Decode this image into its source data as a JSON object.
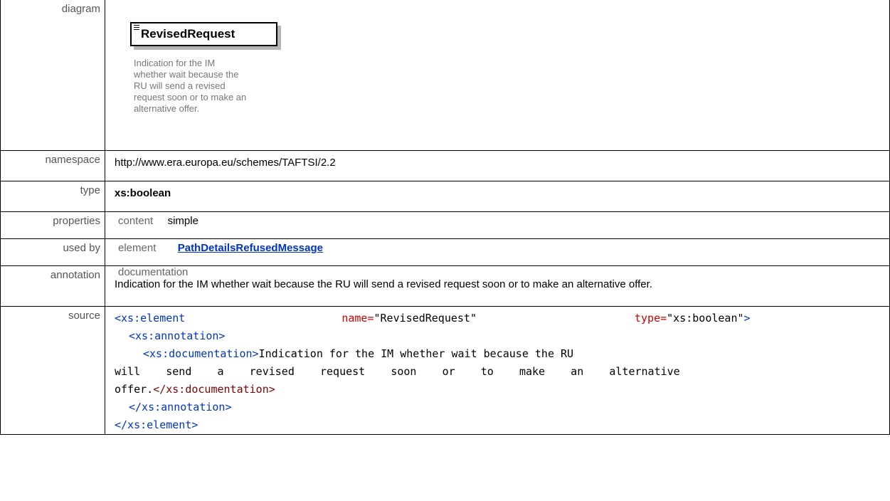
{
  "labels": {
    "diagram": "diagram",
    "namespace": "namespace",
    "type": "type",
    "properties": "properties",
    "used_by": "used by",
    "annotation": "annotation",
    "source": "source"
  },
  "diagram": {
    "element_name": "RevisedRequest",
    "element_doc_lines": [
      "Indication for the IM",
      "whether wait because the",
      "RU will send a revised",
      "request soon or to make an",
      "alternative offer."
    ]
  },
  "namespace": "http://www.era.europa.eu/schemes/TAFTSI/2.2",
  "type": "xs:boolean",
  "properties": {
    "key": "content",
    "value": "simple"
  },
  "used_by": {
    "kind": "element",
    "link": "PathDetailsRefusedMessage"
  },
  "annotation": {
    "key": "documentation",
    "text": "Indication for the IM whether wait because the RU will send a revised request soon or to make an alternative offer."
  },
  "source": {
    "line1": {
      "open": "<xs:element",
      "attr1": "name=",
      "val1": "\"RevisedRequest\"",
      "attr2": "type=",
      "val2": "\"xs:boolean\"",
      "close": ">"
    },
    "line2": "<xs:annotation>",
    "line3_open": "<xs:documentation>",
    "doc_text_1": "Indication for the IM whether wait because the RU",
    "doc_text_2": "will    send    a    revised    request    soon    or    to    make    an    alternative",
    "doc_text_3": "offer.",
    "line3_close": "</xs:documentation>",
    "line4": "</xs:annotation>",
    "line5": "</xs:element>"
  }
}
